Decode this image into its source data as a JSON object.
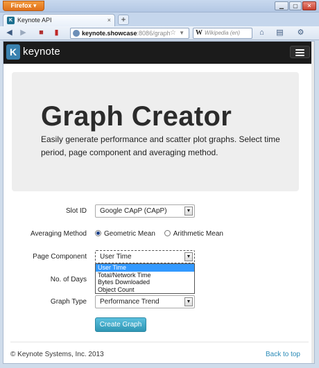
{
  "browser": {
    "app_button": "Firefox",
    "tab_title": "Keynote API",
    "tab_close": "×",
    "new_tab": "+",
    "url_host": "keynote.showcase",
    "url_rest": ":8086/graph",
    "search_engine": "W",
    "search_placeholder": "Wikipedia (en)"
  },
  "site": {
    "brand": "keynote",
    "brand_mark": "K"
  },
  "hero": {
    "title": "Graph Creator",
    "subtitle": "Easily generate performance and scatter plot graphs. Select time period, page component and averaging method."
  },
  "form": {
    "slot_id": {
      "label": "Slot ID",
      "value": "Google CApP (CApP)"
    },
    "averaging": {
      "label": "Averaging Method",
      "options": [
        "Geometric Mean",
        "Arithmetic Mean"
      ],
      "selected": "Geometric Mean"
    },
    "page_component": {
      "label": "Page Component",
      "value": "User Time",
      "options": [
        "User Time",
        "Total/Network Time",
        "Bytes Downloaded",
        "Object Count"
      ],
      "highlighted": "User Time"
    },
    "days": {
      "label": "No. of Days"
    },
    "graph_type": {
      "label": "Graph Type",
      "value": "Performance Trend"
    },
    "submit_label": "Create Graph"
  },
  "footer": {
    "copyright": "© Keynote Systems, Inc. 2013",
    "back_to_top": "Back to top"
  },
  "colors": {
    "nav_bg": "#1b1b1b",
    "hero_bg": "#eeeeee",
    "button": "#49afcd",
    "link": "#2a8ab7",
    "highlight": "#3399ff"
  }
}
